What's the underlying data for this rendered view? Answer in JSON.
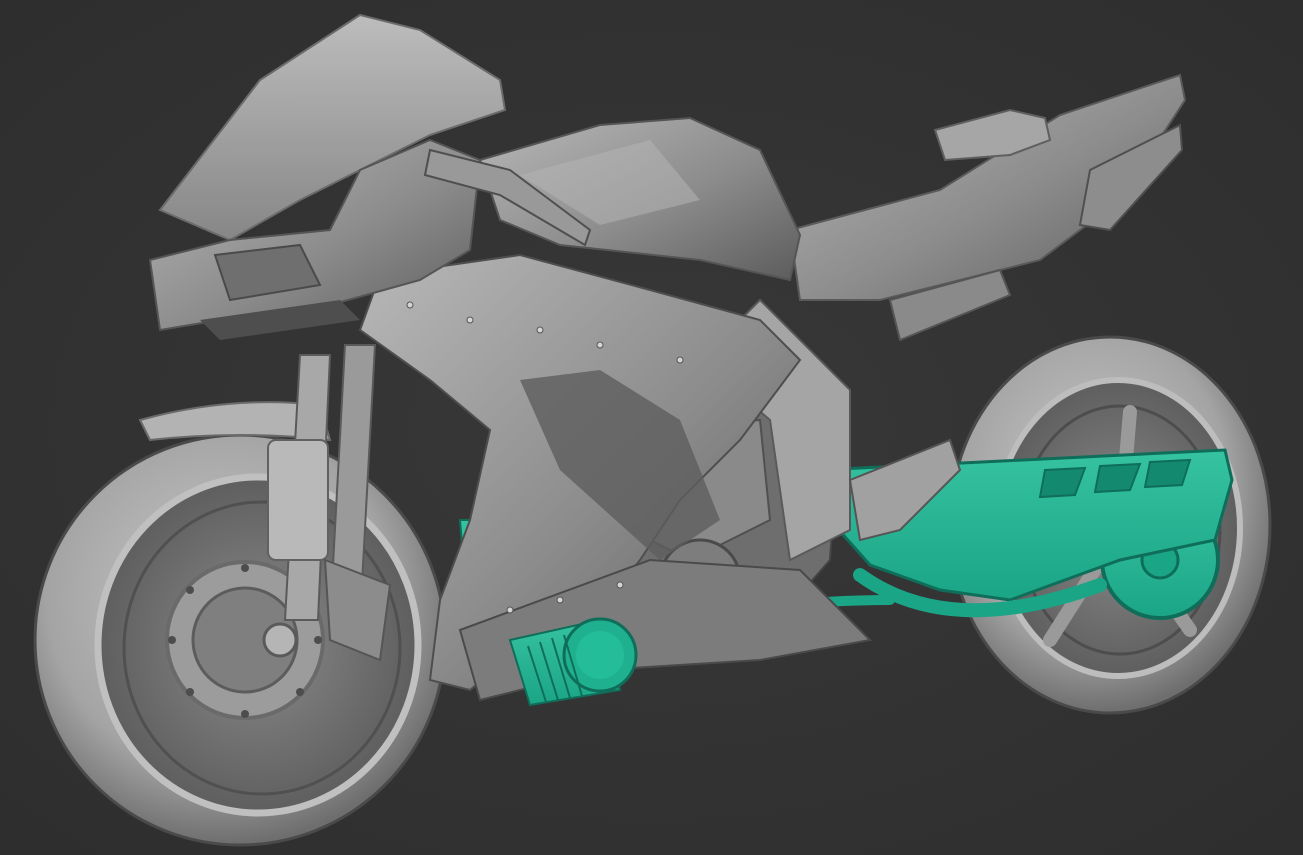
{
  "scene": {
    "background_color": "#333333",
    "model_color": "#a9a9a9",
    "model_dark_color": "#5f5f5f",
    "highlight_color": "#1aa586",
    "highlight_light_color": "#36c3a1"
  }
}
